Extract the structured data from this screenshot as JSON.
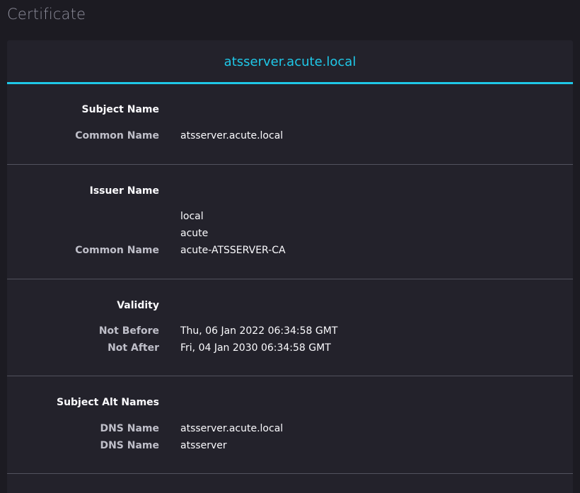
{
  "page": {
    "title": "Certificate"
  },
  "header": {
    "tab_label": "atsserver.acute.local"
  },
  "accent_color": "#1fc8e8",
  "sections": {
    "subject": {
      "heading": "Subject Name",
      "common_name_label": "Common Name",
      "common_name": "atsserver.acute.local"
    },
    "issuer": {
      "heading": "Issuer Name",
      "dc_1": "local",
      "dc_2": "acute",
      "common_name_label": "Common Name",
      "common_name": "acute-ATSSERVER-CA"
    },
    "validity": {
      "heading": "Validity",
      "not_before_label": "Not Before",
      "not_before": "Thu, 06 Jan 2022 06:34:58 GMT",
      "not_after_label": "Not After",
      "not_after": "Fri, 04 Jan 2030 06:34:58 GMT"
    },
    "san": {
      "heading": "Subject Alt Names",
      "dns_label_1": "DNS Name",
      "dns_1": "atsserver.acute.local",
      "dns_label_2": "DNS Name",
      "dns_2": "atsserver"
    }
  }
}
